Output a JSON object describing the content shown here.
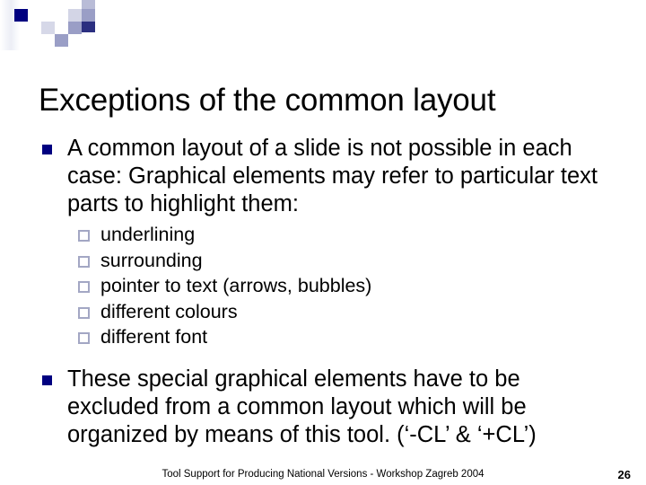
{
  "header": {
    "decoration_colors": {
      "navy": "#000080",
      "bar_start": "#32377f",
      "bar_end": "#ffffff",
      "light_lavender": "#d3d5e6",
      "mid_lavender": "#9a9ec6"
    }
  },
  "title": "Exceptions of the common layout",
  "body": {
    "bullets": [
      {
        "level": 1,
        "marker": "filled-square-bullet",
        "text": "A common layout of a slide is not possible in each case: Graphical elements may refer to particular text parts to highlight them:"
      },
      {
        "level": 1,
        "marker": "filled-square-bullet",
        "text": "These special graphical elements have to be excluded from a common layout which will be organized by means of this tool. (‘-CL’ & ‘+CL’)"
      }
    ],
    "sub_bullets": [
      {
        "marker": "hollow-square-bullet",
        "text": "underlining"
      },
      {
        "marker": "hollow-square-bullet",
        "text": "surrounding"
      },
      {
        "marker": "hollow-square-bullet",
        "text": "pointer to text (arrows, bubbles)"
      },
      {
        "marker": "hollow-square-bullet",
        "text": "different colours"
      },
      {
        "marker": "hollow-square-bullet",
        "text": "different font"
      }
    ]
  },
  "footer": {
    "text": "Tool Support for Producing National Versions - Workshop Zagreb 2004",
    "page_number": "26"
  }
}
